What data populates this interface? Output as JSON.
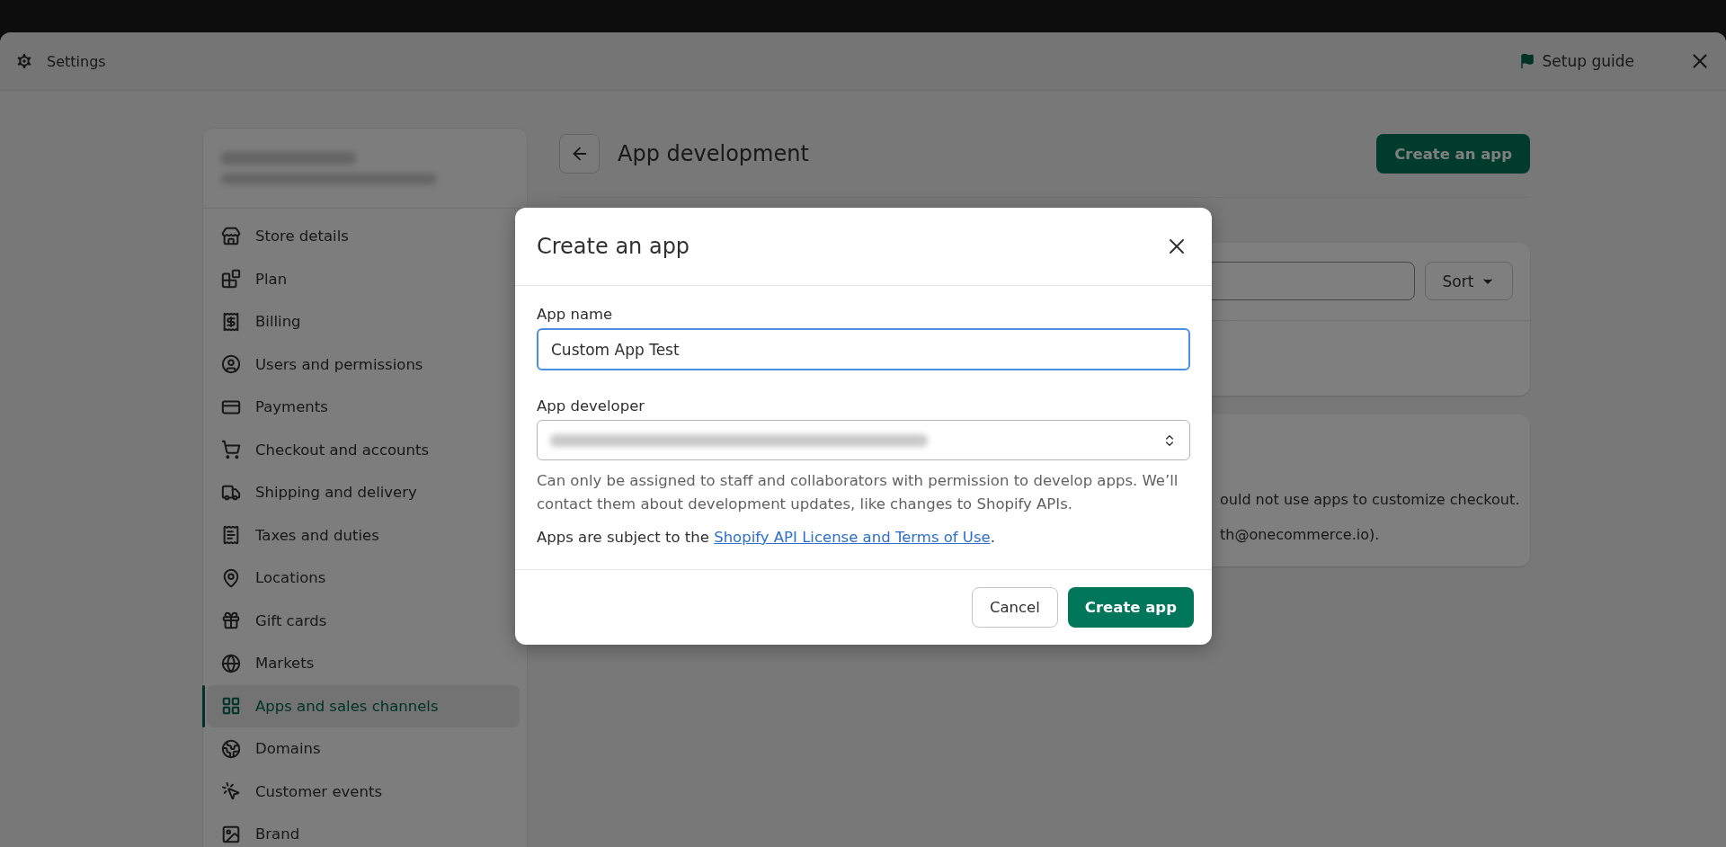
{
  "header": {
    "title": "Settings",
    "setup_guide": "Setup guide"
  },
  "sidebar": {
    "items": [
      {
        "label": "Store details",
        "selected": false
      },
      {
        "label": "Plan",
        "selected": false
      },
      {
        "label": "Billing",
        "selected": false
      },
      {
        "label": "Users and permissions",
        "selected": false
      },
      {
        "label": "Payments",
        "selected": false
      },
      {
        "label": "Checkout and accounts",
        "selected": false
      },
      {
        "label": "Shipping and delivery",
        "selected": false
      },
      {
        "label": "Taxes and duties",
        "selected": false
      },
      {
        "label": "Locations",
        "selected": false
      },
      {
        "label": "Gift cards",
        "selected": false
      },
      {
        "label": "Markets",
        "selected": false
      },
      {
        "label": "Apps and sales channels",
        "selected": true
      },
      {
        "label": "Domains",
        "selected": false
      },
      {
        "label": "Customer events",
        "selected": false
      },
      {
        "label": "Brand",
        "selected": false
      }
    ]
  },
  "page": {
    "title": "App development",
    "primary_action": "Create an app"
  },
  "list_card": {
    "sort": "Sort"
  },
  "notice_card": {
    "lines": [
      "ould not use apps to customize checkout.",
      "th@onecommerce.io)."
    ]
  },
  "modal": {
    "title": "Create an app",
    "fields": [
      {
        "kind": "text",
        "label": "App name",
        "value": "Custom App Test",
        "focused": true
      },
      {
        "kind": "select",
        "label": "App developer",
        "focused": false
      }
    ],
    "help": "Can only be assigned to staff and collaborators with permission to develop apps. We’ll contact them about development updates, like changes to Shopify APIs.",
    "terms": {
      "prefix": "Apps are subject to the ",
      "link": "Shopify API License and Terms of Use",
      "suffix": "."
    },
    "buttons": [
      {
        "kind": "secondary",
        "label": "Cancel"
      },
      {
        "kind": "primary",
        "label": "Create app"
      }
    ]
  }
}
